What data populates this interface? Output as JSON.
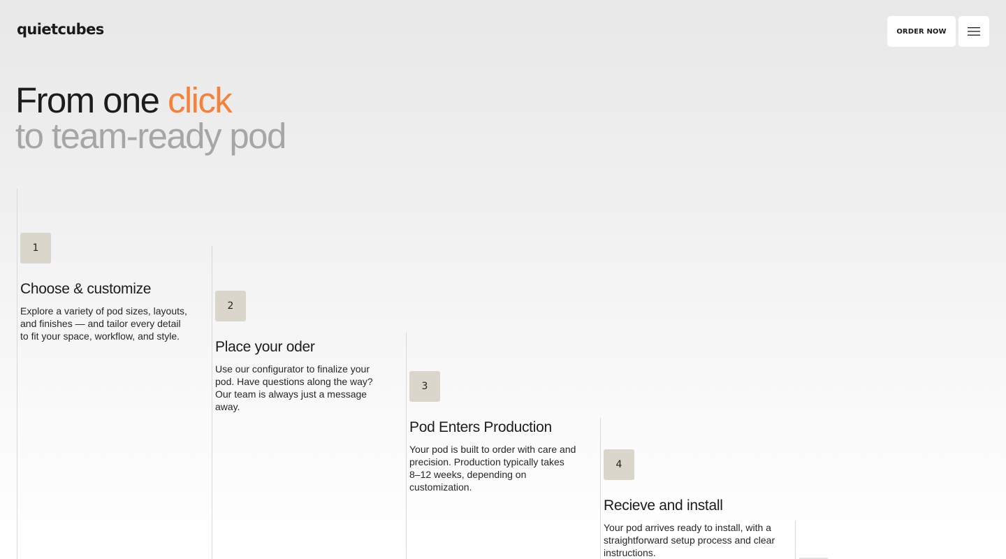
{
  "header": {
    "logo": "quietcubes",
    "order_label": "ORDER NOW",
    "menu_icon": "hamburger-menu-icon"
  },
  "hero": {
    "line1_prefix": "From one ",
    "line1_accent": "click",
    "line2": "to team-ready pod",
    "accent_color": "#f5813a"
  },
  "steps": [
    {
      "number": "1",
      "title": "Choose & customize",
      "description": "Explore a variety of pod sizes, layouts, and finishes — and tailor every detail to fit your space, workflow, and style."
    },
    {
      "number": "2",
      "title": "Place your oder",
      "description": "Use our configurator to finalize your pod. Have questions along the way? Our team is always just a message away."
    },
    {
      "number": "3",
      "title": "Pod Enters Production",
      "description": "Your pod is built to order with care and precision. Production typically takes 8–12 weeks, depending on customization."
    },
    {
      "number": "4",
      "title": "Recieve and install",
      "description": "Your pod arrives ready to install, with a straightforward setup process and clear instructions."
    }
  ],
  "colors": {
    "step_badge": "#dbd6cb",
    "text_dark": "#1c1c1c",
    "text_muted": "#a6a6a6"
  }
}
